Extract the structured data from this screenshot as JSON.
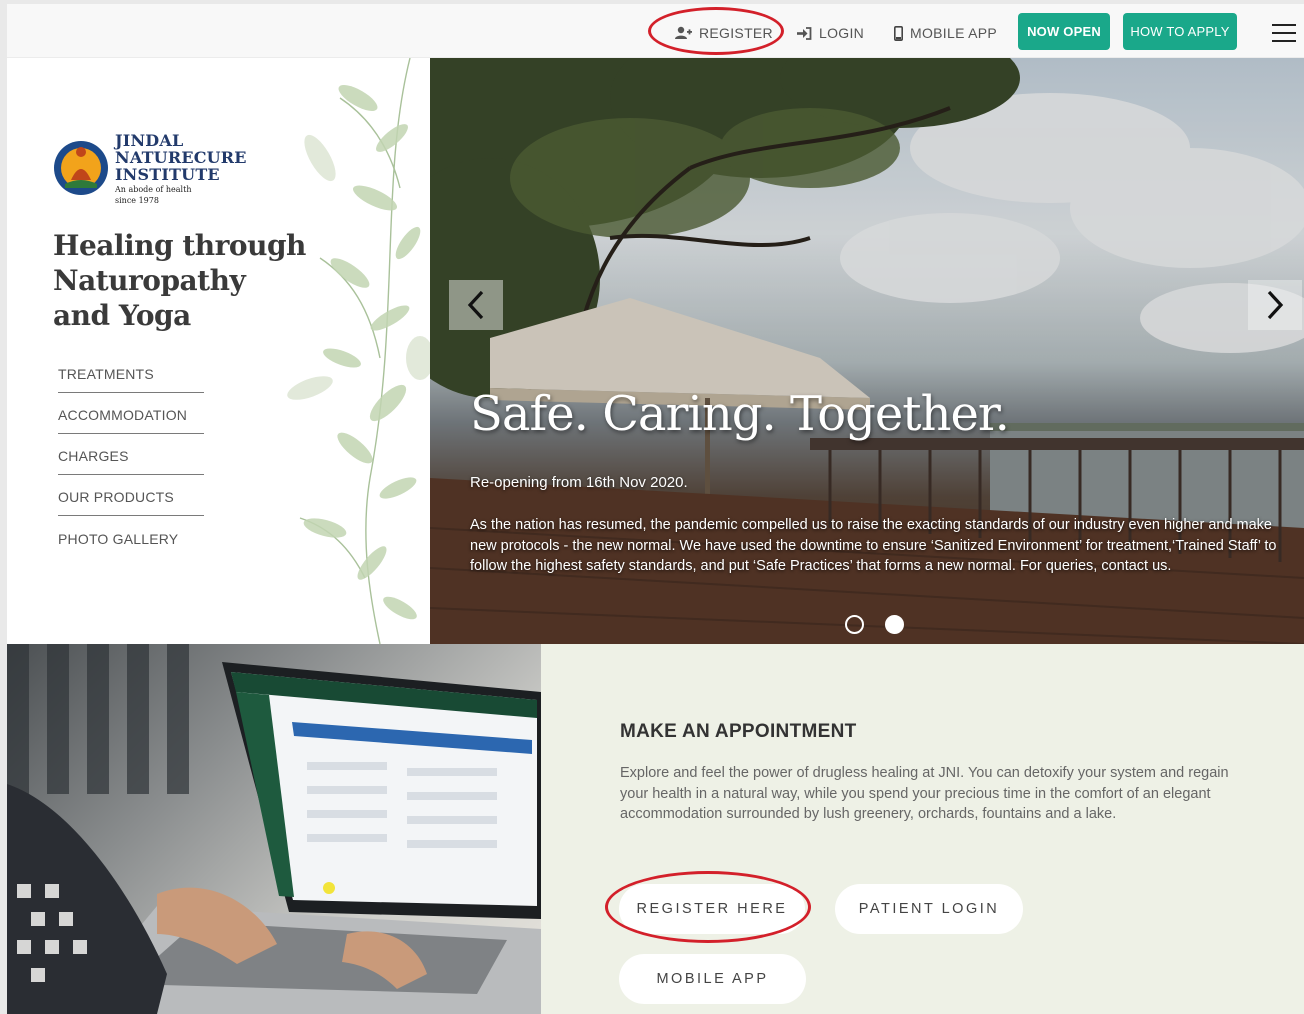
{
  "topbar": {
    "register_label": "REGISTER",
    "login_label": "LOGIN",
    "mobile_app_label": "MOBILE APP",
    "now_open_label": "NOW OPEN",
    "how_to_apply_label": "HOW TO APPLY",
    "icons": [
      "add-user-icon",
      "sign-in-icon",
      "mobile-icon",
      "hamburger-menu-icon"
    ]
  },
  "brand": {
    "line1": "JINDAL",
    "line2": "NATURECURE",
    "line3": "INSTITUTE",
    "tagline1": "An abode of health",
    "tagline2": "since 1978"
  },
  "hero": {
    "heading_line1": "Healing through",
    "heading_line2": "Naturopathy",
    "heading_line3": "and Yoga"
  },
  "side_menu": {
    "items": [
      {
        "label": "TREATMENTS"
      },
      {
        "label": "ACCOMMODATION"
      },
      {
        "label": "CHARGES"
      },
      {
        "label": "OUR PRODUCTS"
      },
      {
        "label": "PHOTO GALLERY"
      }
    ]
  },
  "slider": {
    "title": "Safe. Caring. Together.",
    "subtitle": "Re-opening from 16th Nov 2020.",
    "body": "As the nation has resumed, the pandemic compelled us to raise the exacting standards of our industry even higher and make new protocols - the new normal. We have used the downtime to ensure ‘Sanitized Environment’ for treatment,‘Trained Staff’ to follow the highest safety standards, and put ‘Safe Practices’ that forms a new normal. For queries, contact us.",
    "slide_count": 2,
    "active_slide": 2
  },
  "appointment": {
    "title": "MAKE AN APPOINTMENT",
    "text": "Explore and feel the power of drugless healing at JNI. You can detoxify your system and regain your health in a natural way, while you spend your precious time in the comfort of an elegant accommodation surrounded by lush greenery, orchards, fountains and a lake.",
    "register_here_label": "REGISTER HERE",
    "patient_login_label": "PATIENT LOGIN",
    "mobile_app_label": "MOBILE APP"
  },
  "colors": {
    "accent_green": "#1aa88a",
    "annotation_red": "#d3202a",
    "appointment_bg": "#eef1e6"
  }
}
